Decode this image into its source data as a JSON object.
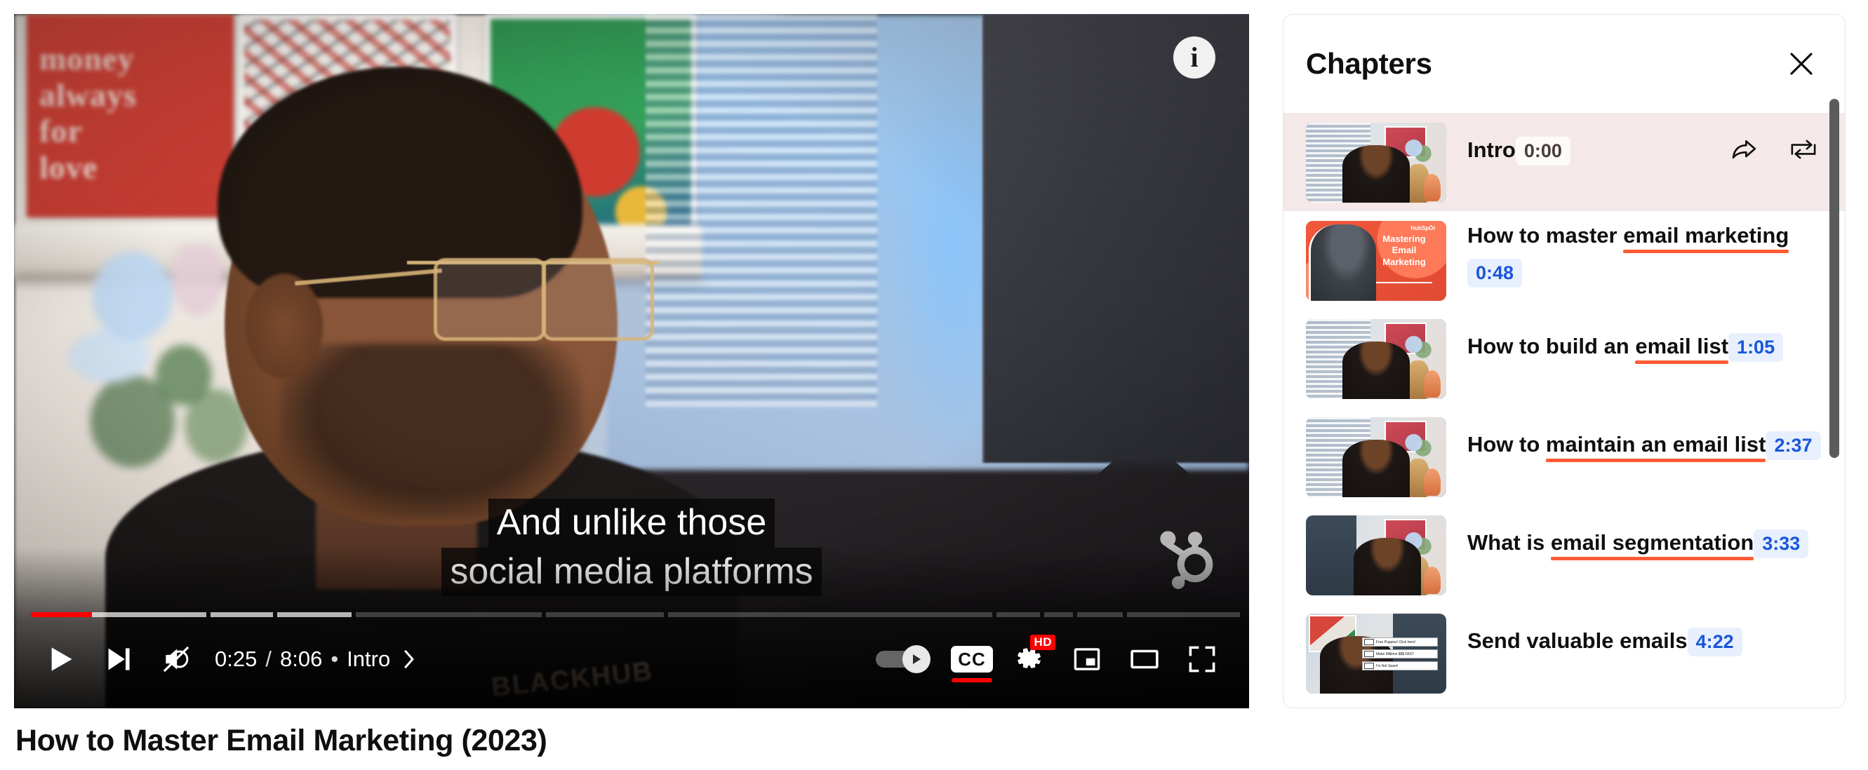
{
  "player": {
    "info_button_glyph": "i",
    "watermark": "hubspot-sprocket",
    "hoodie_text": "BLACKHUB",
    "captions": {
      "line1": "And unlike those",
      "line2": "social media platforms"
    },
    "controls": {
      "play_label": "Play",
      "next_label": "Next video",
      "mute_label": "Unmute",
      "current_time": "0:25",
      "separator": "/",
      "duration": "8:06",
      "bullet": "•",
      "chapter_name": "Intro",
      "chapter_chevron": "chevron-right",
      "autoplay_label": "Autoplay is on",
      "captions_label": "CC",
      "settings_label": "Settings",
      "settings_badge": "HD",
      "miniplayer_label": "Miniplayer",
      "theater_label": "Theater mode",
      "fullscreen_label": "Full screen"
    },
    "progress": {
      "played_pct": 5.2,
      "accent_color": "#ff0000",
      "segments": [
        {
          "width_pct": 14.6,
          "buffered_pct": 100,
          "played_pct": 35
        },
        {
          "width_pct": 5.2,
          "buffered_pct": 100,
          "played_pct": 0
        },
        {
          "width_pct": 6.2,
          "buffered_pct": 100,
          "played_pct": 0
        },
        {
          "width_pct": 15.5,
          "buffered_pct": 0,
          "played_pct": 0
        },
        {
          "width_pct": 9.8,
          "buffered_pct": 0,
          "played_pct": 0
        },
        {
          "width_pct": 27.0,
          "buffered_pct": 0,
          "played_pct": 0
        },
        {
          "width_pct": 3.6,
          "buffered_pct": 0,
          "played_pct": 0
        },
        {
          "width_pct": 2.4,
          "buffered_pct": 0,
          "played_pct": 0
        },
        {
          "width_pct": 3.8,
          "buffered_pct": 0,
          "played_pct": 0
        },
        {
          "width_pct": 9.4,
          "buffered_pct": 0,
          "played_pct": 0
        }
      ]
    }
  },
  "video_title": "How to Master Email Marketing (2023)",
  "chapters_panel": {
    "title": "Chapters",
    "close_label": "Close",
    "accent_underline_color": "#ff5c35",
    "active_row_color": "#f4e9e8",
    "time_badge_color": "#1a56db",
    "items": [
      {
        "label_plain": "Intro",
        "label_highlight": "",
        "time": "0:00",
        "active": true,
        "thumb": "room-speaking",
        "actions": [
          "share-icon",
          "loop-icon"
        ]
      },
      {
        "label_plain": "How to master ",
        "label_highlight": "email marketing",
        "time": "0:48",
        "active": false,
        "thumb": "hubspot-branded",
        "actions": []
      },
      {
        "label_plain": "How to build an ",
        "label_highlight": "email list",
        "time": "1:05",
        "active": false,
        "thumb": "room-gavel",
        "actions": []
      },
      {
        "label_plain": "How to ",
        "label_highlight": "maintain an email list",
        "time": "2:37",
        "active": false,
        "thumb": "room-hand",
        "actions": []
      },
      {
        "label_plain": "What is ",
        "label_highlight": "email segmentation",
        "time": "3:33",
        "active": false,
        "thumb": "room-dark-left",
        "actions": []
      },
      {
        "label_plain": "Send valuable emails",
        "label_highlight": "",
        "time": "4:22",
        "active": false,
        "thumb": "spam-emails",
        "actions": []
      }
    ],
    "scrollbar": {
      "thumb_color": "#5b5b5b"
    }
  }
}
